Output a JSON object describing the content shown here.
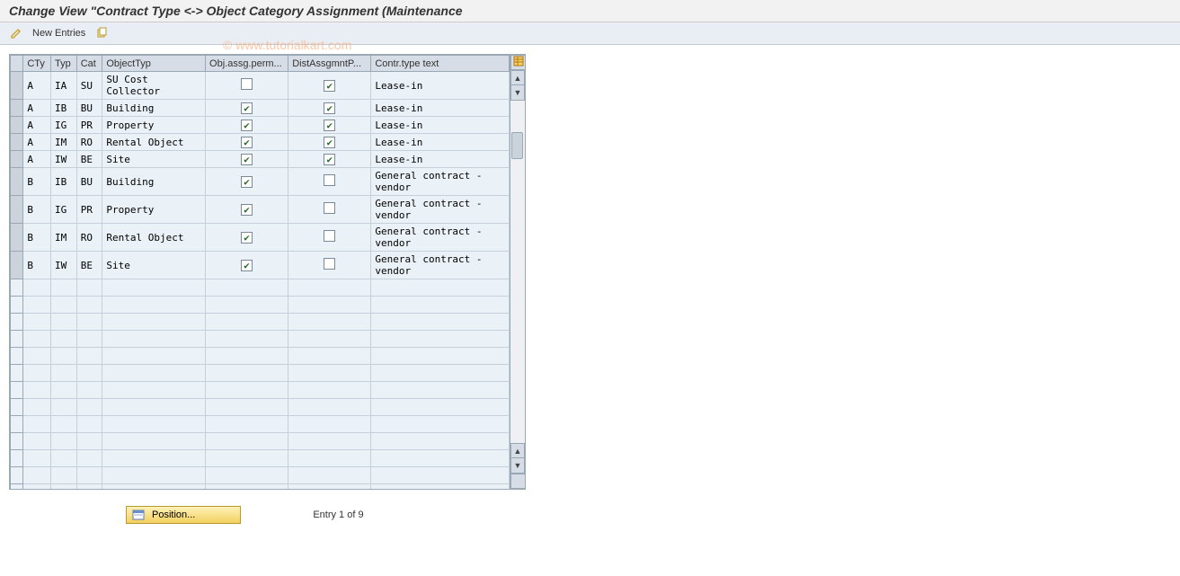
{
  "title": "Change View \"Contract Type <-> Object Category Assignment (Maintenance",
  "toolbar": {
    "new_entries_label": "New Entries"
  },
  "watermark": "© www.tutorialkart.com",
  "table": {
    "headers": {
      "cty": "CTy",
      "typ": "Typ",
      "cat": "Cat",
      "objtyp": "ObjectTyp",
      "perm": "Obj.assg.perm...",
      "dist": "DistAssgmntP...",
      "text": "Contr.type text"
    },
    "rows": [
      {
        "cty": "A",
        "typ": "IA",
        "cat": "SU",
        "obj": "SU Cost Collector",
        "perm": false,
        "dist": true,
        "text": "Lease-in"
      },
      {
        "cty": "A",
        "typ": "IB",
        "cat": "BU",
        "obj": "Building",
        "perm": true,
        "dist": true,
        "text": "Lease-in"
      },
      {
        "cty": "A",
        "typ": "IG",
        "cat": "PR",
        "obj": "Property",
        "perm": true,
        "dist": true,
        "text": "Lease-in"
      },
      {
        "cty": "A",
        "typ": "IM",
        "cat": "RO",
        "obj": "Rental Object",
        "perm": true,
        "dist": true,
        "text": "Lease-in"
      },
      {
        "cty": "A",
        "typ": "IW",
        "cat": "BE",
        "obj": "Site",
        "perm": true,
        "dist": true,
        "text": "Lease-in"
      },
      {
        "cty": "B",
        "typ": "IB",
        "cat": "BU",
        "obj": "Building",
        "perm": true,
        "dist": false,
        "text": "General contract - vendor"
      },
      {
        "cty": "B",
        "typ": "IG",
        "cat": "PR",
        "obj": "Property",
        "perm": true,
        "dist": false,
        "text": "General contract - vendor"
      },
      {
        "cty": "B",
        "typ": "IM",
        "cat": "RO",
        "obj": "Rental Object",
        "perm": true,
        "dist": false,
        "text": "General contract - vendor"
      },
      {
        "cty": "B",
        "typ": "IW",
        "cat": "BE",
        "obj": "Site",
        "perm": true,
        "dist": false,
        "text": "General contract - vendor"
      }
    ],
    "empty_rows": 14
  },
  "footer": {
    "position_label": "Position...",
    "entry_text": "Entry 1 of 9"
  }
}
